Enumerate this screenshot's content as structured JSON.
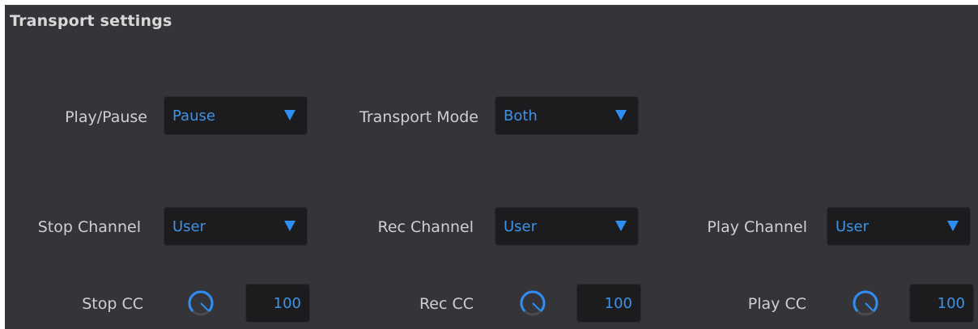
{
  "section": {
    "title": "Transport settings"
  },
  "row1": {
    "play_pause": {
      "label": "Play/Pause",
      "value": "Pause"
    },
    "transport_mode": {
      "label": "Transport Mode",
      "value": "Both"
    }
  },
  "row2": {
    "stop_channel": {
      "label": "Stop Channel",
      "value": "User"
    },
    "rec_channel": {
      "label": "Rec Channel",
      "value": "User"
    },
    "play_channel": {
      "label": "Play Channel",
      "value": "User"
    }
  },
  "row3": {
    "stop_cc": {
      "label": "Stop CC",
      "value": "100"
    },
    "rec_cc": {
      "label": "Rec CC",
      "value": "100"
    },
    "play_cc": {
      "label": "Play CC",
      "value": "100"
    }
  },
  "colors": {
    "background": "#353539",
    "field": "#1c1c1f",
    "accent": "#2f8ef3",
    "label_text": "#cfcfcf"
  }
}
